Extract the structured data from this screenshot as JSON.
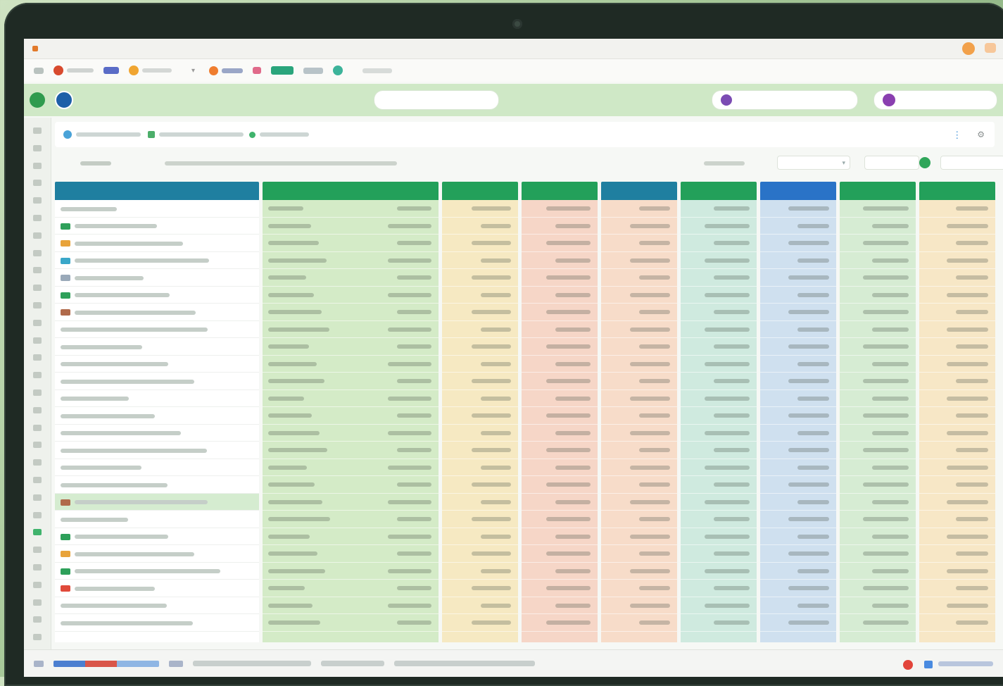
{
  "window": {
    "app_name": "",
    "title": ""
  },
  "quickbar": {
    "items": [],
    "right_text": ""
  },
  "header": {
    "project": "",
    "search_pill": "",
    "center_pill": "",
    "user_pill": ""
  },
  "breadcrumb": {
    "items": []
  },
  "filter": {
    "label": "",
    "description": "",
    "field_label": ""
  },
  "colors": {
    "header_teal": "#1f7fa0",
    "header_green": "#23a05a",
    "header_blue": "#2a73c7",
    "col_green": "#d4ebc7",
    "col_yellow": "#f6e9c2",
    "col_salmon": "#f6d6c7",
    "col_peach": "#f7dcc9",
    "col_mint": "#cfeadf",
    "col_lightblue": "#cfe0ef",
    "col_lightgreen": "#d6ecd3",
    "col_cream": "#f7e7c6",
    "accent_green": "#2f9b4e"
  },
  "grid": {
    "columns": [
      {
        "title": "",
        "color": "#1f7fa0",
        "fill": "#ffffff"
      },
      {
        "title": "",
        "color": "#23a05a",
        "fill": "#d4ebc7"
      },
      {
        "title": "",
        "color": "#23a05a",
        "fill": "#f6e9c2"
      },
      {
        "title": "",
        "color": "#23a05a",
        "fill": "#f6d6c7"
      },
      {
        "title": "",
        "color": "#1f7fa0",
        "fill": "#f7dcc9"
      },
      {
        "title": "",
        "color": "#23a05a",
        "fill": "#cfeadf"
      },
      {
        "title": "",
        "color": "#2a73c7",
        "fill": "#cfe0ef"
      },
      {
        "title": "",
        "color": "#23a05a",
        "fill": "#d6ecd3"
      },
      {
        "title": "",
        "color": "#23a05a",
        "fill": "#f7e7c6"
      }
    ],
    "row_count": 25,
    "row_icons": [
      "none",
      "spreadsheet-icon",
      "folder-icon",
      "link-icon",
      "document-icon",
      "spreadsheet-icon",
      "image-icon",
      "none",
      "none",
      "none",
      "none",
      "none",
      "none",
      "none",
      "none",
      "none",
      "none",
      "image-icon",
      "none",
      "spreadsheet-icon",
      "folder-icon",
      "spreadsheet-icon",
      "alert-icon",
      "none",
      "none"
    ],
    "selected_row": 17
  },
  "statusbar": {
    "segments": []
  }
}
